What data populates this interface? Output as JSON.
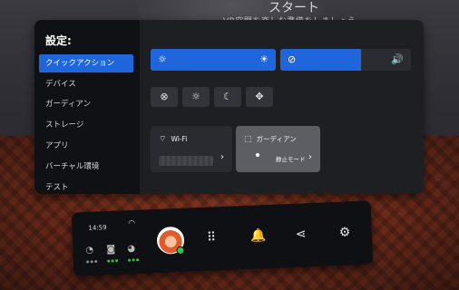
{
  "background": {
    "title": "スタート",
    "subtitle": "VR空間を楽しむ準備をしましょう"
  },
  "settings": {
    "title": "設定:",
    "menu": [
      {
        "label": "クイックアクション",
        "active": true
      },
      {
        "label": "デバイス"
      },
      {
        "label": "ガーディアン"
      },
      {
        "label": "ストレージ"
      },
      {
        "label": "アプリ"
      },
      {
        "label": "バーチャル環境"
      },
      {
        "label": "テスト"
      }
    ],
    "brightness": {
      "icon": "brightness-icon",
      "level": 1.0
    },
    "volume": {
      "icon": "volume-icon",
      "level": 0.62
    },
    "quick_buttons": [
      "mic-mute-icon",
      "brightness-toggle-icon",
      "night-mode-icon",
      "recenter-icon"
    ],
    "wifi": {
      "label": "Wi-Fi"
    },
    "guardian": {
      "label": "ガーディアン",
      "mode": "静止モード"
    }
  },
  "systembar": {
    "time": "14:59",
    "accent": "#1f66dd"
  }
}
